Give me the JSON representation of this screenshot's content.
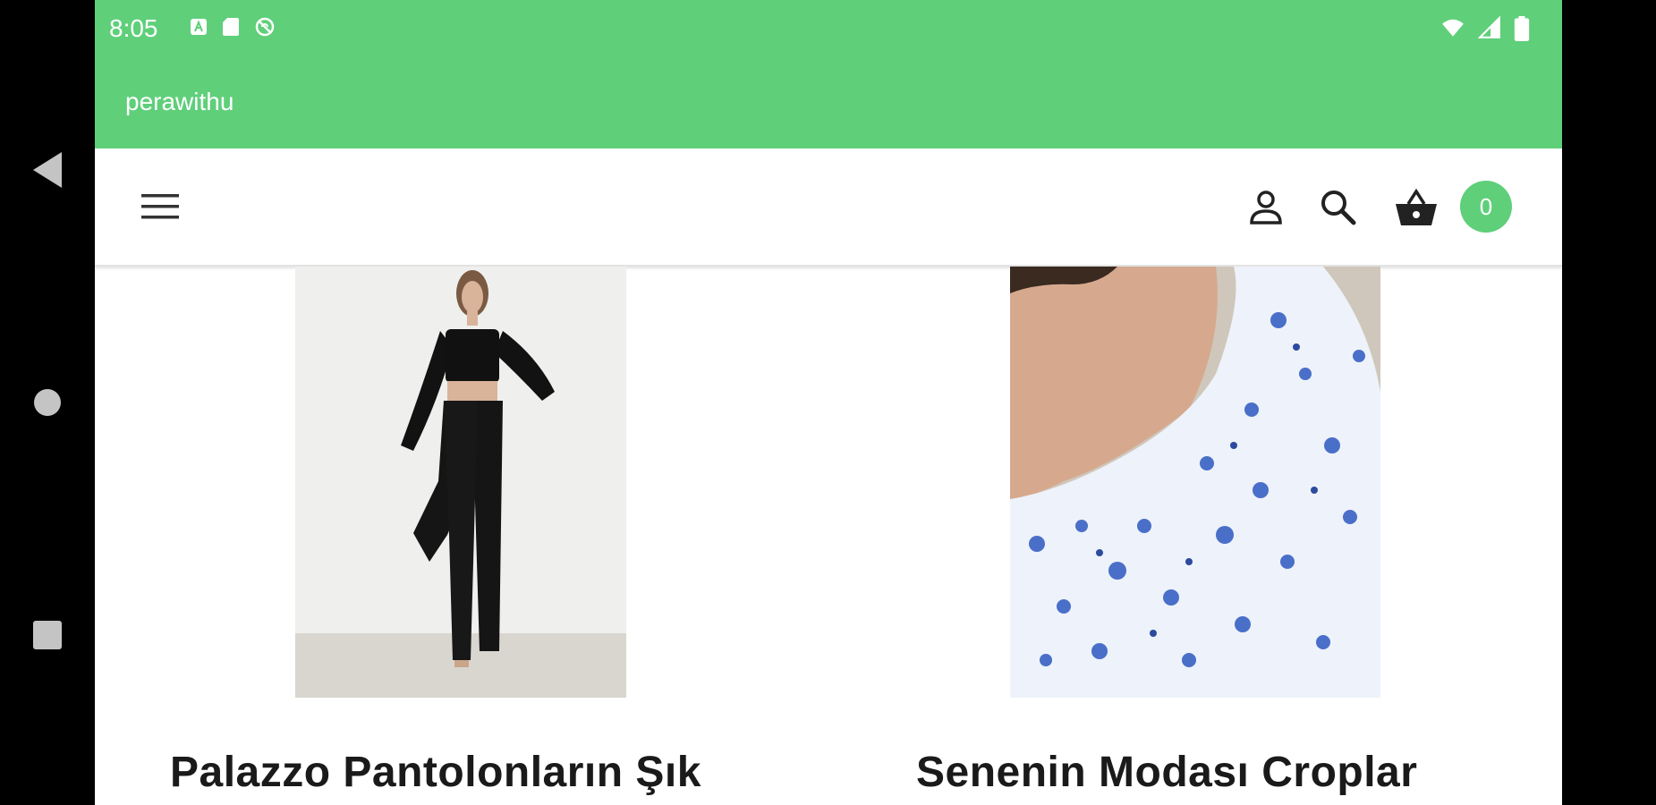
{
  "status_bar": {
    "time": "8:05",
    "left_icons": [
      "app-a-icon",
      "sd-card-icon",
      "sync-disabled-icon"
    ],
    "right_icons": [
      "wifi-icon",
      "signal-icon",
      "battery-icon"
    ]
  },
  "app_bar": {
    "title": "perawithu"
  },
  "header": {
    "icons": [
      "menu-icon",
      "user-icon",
      "search-icon",
      "basket-icon"
    ],
    "cart_count": "0"
  },
  "products": [
    {
      "title": "Palazzo Pantolonların Şık",
      "image": "woman-in-black-outfit-photo"
    },
    {
      "title": "Senenin Modası Croplar",
      "image": "blue-floral-crop-top-photo"
    }
  ],
  "colors": {
    "accent": "#5fcf7a",
    "text": "#1a1a1a",
    "background": "#ffffff"
  },
  "nav_bar": {
    "buttons": [
      "back-icon",
      "home-icon",
      "recents-icon"
    ]
  }
}
